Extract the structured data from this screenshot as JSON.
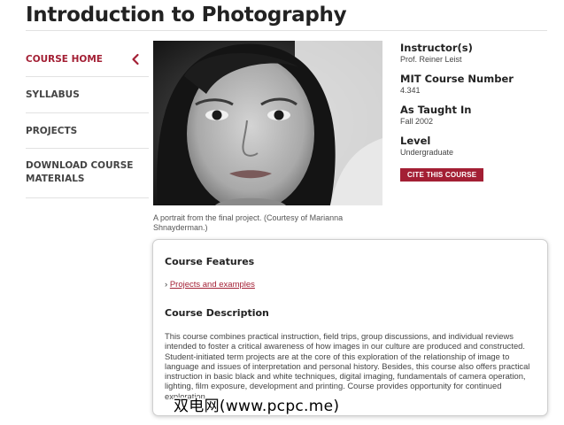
{
  "page_title": "Introduction to Photography",
  "sidebar": {
    "items": [
      {
        "label": "COURSE HOME"
      },
      {
        "label": "SYLLABUS"
      },
      {
        "label": "PROJECTS"
      },
      {
        "label": "DOWNLOAD COURSE MATERIALS"
      }
    ]
  },
  "photo": {
    "caption": "A portrait from the final project. (Courtesy of Marianna Shnayderman.)"
  },
  "course_info": {
    "instructor_label": "Instructor(s)",
    "instructor": "Prof. Reiner Leist",
    "number_label": "MIT Course Number",
    "number": "4.341",
    "taught_label": "As Taught In",
    "taught": "Fall 2002",
    "level_label": "Level",
    "level": "Undergraduate",
    "cite_button": "CITE THIS COURSE"
  },
  "features": {
    "heading": "Course Features",
    "links": [
      {
        "label": "Projects and examples"
      }
    ]
  },
  "description": {
    "heading": "Course Description",
    "text": "This course combines practical instruction, field trips, group discussions, and individual reviews intended to foster a critical awareness of how images in our culture are produced and constructed. Student-initiated term projects are at the core of this exploration of the relationship of image to language and issues of interpretation and personal history. Besides, this course also offers practical instruction in basic black and white techniques, digital imaging, fundamentals of camera operation, lighting, film exposure, development and printing. Course provides opportunity for continued exploration."
  },
  "watermark": "双电网(www.pcpc.me)",
  "colors": {
    "accent": "#a31f34"
  }
}
